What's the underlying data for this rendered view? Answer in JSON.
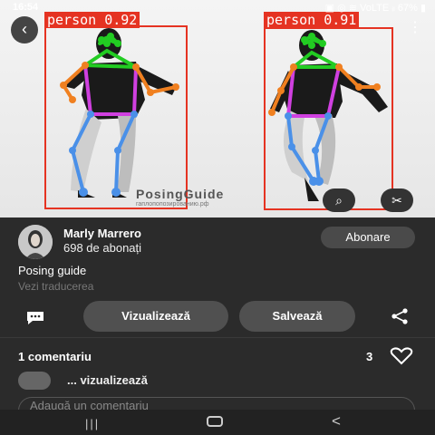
{
  "status": {
    "time": "16:54",
    "right": "▣ ◎ ≋ VoLTE ᵢₗ 67% ▮"
  },
  "header": {
    "back_icon": "‹",
    "more_icon": "⋮"
  },
  "detections": [
    {
      "label": "person",
      "score": "0.92",
      "color": "#e53322"
    },
    {
      "label": "person",
      "score": "0.91",
      "color": "#e53322"
    }
  ],
  "image": {
    "watermark": "PosingGuide",
    "watermark_sub": "гаплопопозированию.рф"
  },
  "overlay": {
    "lens_icon": "⌕",
    "cut_icon": "✂"
  },
  "pin": {
    "author": "Marly Marrero",
    "followers": "698 de abonați",
    "follow_label": "Abonare",
    "title": "Posing guide",
    "translate": "Vezi traducerea"
  },
  "actions": {
    "view_label": "Vizualizează",
    "save_label": "Salvează"
  },
  "comments": {
    "count_label": "1 comentariu",
    "likes": "3",
    "preview": "... vizualizează",
    "input_placeholder": "Adaugă un comentariu"
  },
  "nav": {
    "recents": "|||",
    "back": "<"
  }
}
